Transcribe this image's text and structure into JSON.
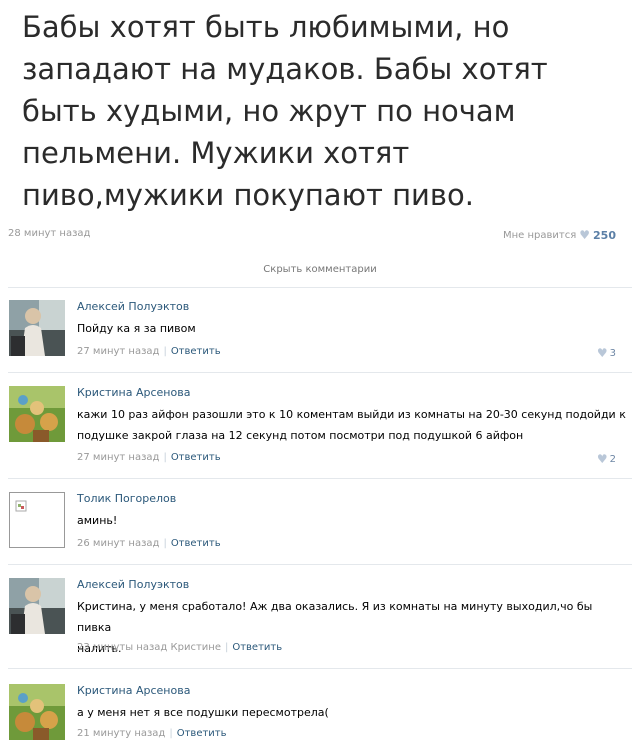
{
  "post": {
    "text_lines": [
      "Бабы хотят быть любимыми, но",
      "западают на мудаков. Бабы хотят",
      "быть худыми, но жрут по ночам",
      "пельмени. Мужики хотят",
      "пиво,мужики покупают пиво."
    ],
    "time": "28 минут назад",
    "like_label": "Мне нравится",
    "like_count": "250"
  },
  "hide_comments_label": "Скрыть комментарии",
  "comments": [
    {
      "author": "Алексей Полуэктов",
      "text_lines": [
        "Пойду ка я за пивом"
      ],
      "time": "27 минут назад",
      "reply_label": "Ответить",
      "likes": "3"
    },
    {
      "author": "Кристина Арсенова",
      "text_lines": [
        "кажи 10 раз айфон разошли это к 10 коментам выйди из комнаты на 20-30 секунд подойди к",
        "подушке закрой глаза на 12 секунд потом посмотри под подушкой 6 айфон"
      ],
      "time": "27 минут назад",
      "reply_label": "Ответить",
      "likes": "2"
    },
    {
      "author": "Толик Погорелов",
      "text_lines": [
        "аминь!"
      ],
      "time": "26 минут назад",
      "reply_label": "Ответить"
    },
    {
      "author": "Алексей Полуэктов",
      "text_lines": [
        "Кристина, у меня сработало! Аж два оказались. Я из комнаты на минуту выходил,чо бы пивка",
        "налить."
      ],
      "time": "23 минуты назад Кристине",
      "reply_label": "Ответить"
    },
    {
      "author": "Кристина Арсенова",
      "text_lines": [
        "а у меня нет я все подушки пересмотрела("
      ],
      "time": "21 минуту назад",
      "reply_label": "Ответить"
    }
  ],
  "icons": {
    "heart": "heart-icon",
    "no_avatar": "broken-image-icon"
  }
}
